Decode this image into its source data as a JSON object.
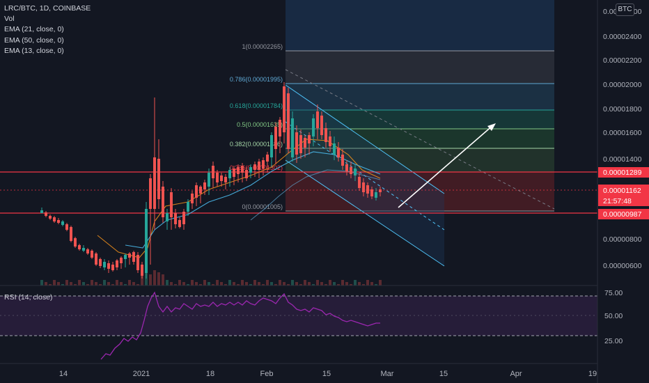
{
  "legend": {
    "symbol_line": "LRC/BTC, 1D, COINBASE",
    "vol": "Vol",
    "ema21": "EMA (21, close, 0)",
    "ema50": "EMA (50, close, 0)",
    "ema13": "EMA (13, close, 0)"
  },
  "rsi": {
    "label": "RSI (14, close)",
    "levels": [
      "75.00",
      "50.00",
      "25.00"
    ]
  },
  "currency_button": "BTC",
  "price_axis": {
    "ticks": [
      "0.00002600",
      "0.00002400",
      "0.00002200",
      "0.00002000",
      "0.00001800",
      "0.00001600",
      "0.00001400",
      "0.00001200",
      "0.00001000",
      "0.00000800",
      "0.00000600"
    ],
    "badges": [
      {
        "text": "0.00001289",
        "color": "#f23645"
      },
      {
        "text": "0.00001162",
        "color": "#f23645"
      },
      {
        "text": "21:57:48",
        "color": "#f23645"
      },
      {
        "text": "0.00000987",
        "color": "#f23645"
      }
    ]
  },
  "time_axis": [
    "14",
    "2021",
    "18",
    "Feb",
    "15",
    "Mar",
    "15",
    "Apr",
    "19"
  ],
  "fibonacci": [
    {
      "label": "1(0.00002265)",
      "color": "#787b86"
    },
    {
      "label": "0.786(0.00001995)",
      "color": "#5fa8d3"
    },
    {
      "label": "0.618(0.00001784)",
      "color": "#26a69a"
    },
    {
      "label": "0.5(0.00001635)",
      "color": "#81c784"
    },
    {
      "label": "0.382(0.00001486)",
      "color": "#a5d6a7"
    },
    {
      "label": "0.236(0.00001302)",
      "color": "#f23645"
    },
    {
      "label": "0(0.00001005)",
      "color": "#787b86"
    }
  ],
  "colors": {
    "up": "#26a69a",
    "down": "#ef5350",
    "resistance": "#f23645",
    "channel": "#4fc3f7",
    "arrow": "#ffffff"
  }
}
